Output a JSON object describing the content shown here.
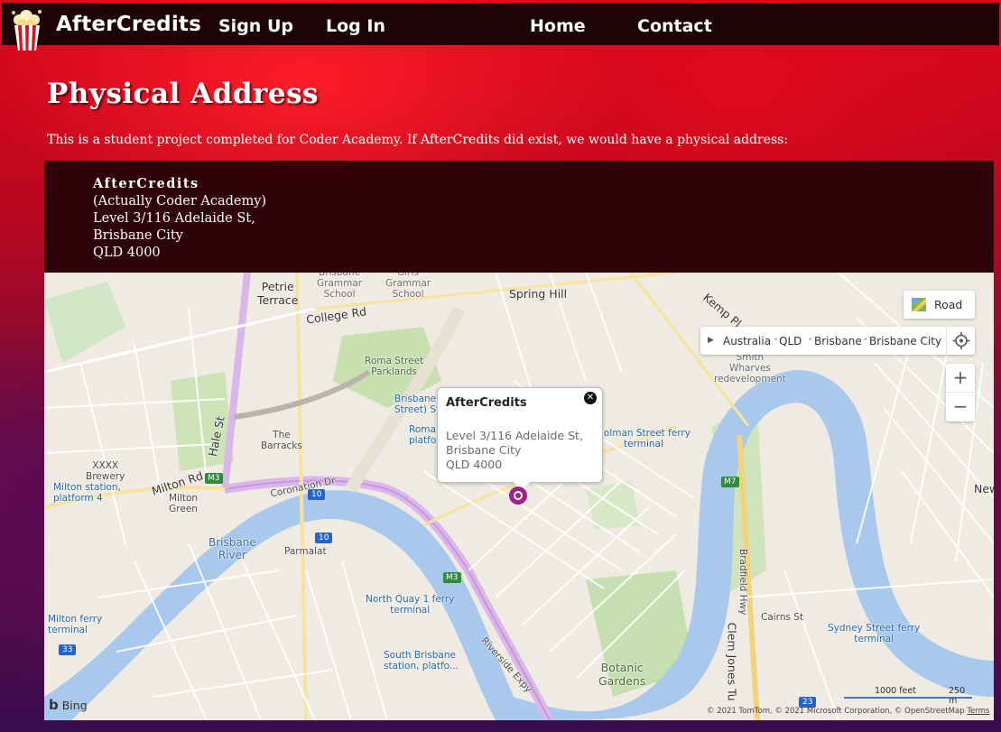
{
  "nav": {
    "brand": "AfterCredits",
    "links": {
      "signup": "Sign Up",
      "login": "Log In",
      "home": "Home",
      "contact": "Contact"
    }
  },
  "page": {
    "title": "Physical Address",
    "intro": "This is a student project completed for Coder Academy. If AfterCredits did exist, we would have a physical address:"
  },
  "address": {
    "name": "AfterCredits",
    "lines": [
      "(Actually Coder Academy)",
      "Level 3/116 Adelaide St,",
      "Brisbane City",
      "QLD 4000"
    ]
  },
  "map": {
    "popup": {
      "title": "AfterCredits",
      "lines": [
        "Level 3/116 Adelaide St,",
        "Brisbane City",
        "QLD 4000"
      ]
    },
    "style_button": "Road",
    "breadcrumb": [
      "Australia",
      "QLD",
      "Brisbane",
      "Brisbane City"
    ],
    "zoom": {
      "in": "+",
      "out": "−"
    },
    "branding": "Bing",
    "scale": {
      "feet": "1000 feet",
      "meters": "250 m"
    },
    "copyright": "© 2021 TomTom, © 2021 Microsoft Corporation, © OpenStreetMap",
    "terms": "Terms",
    "labels": {
      "petrie_terrace": "Petrie\nTerrace",
      "spring_hill": "Spring Hill",
      "brisbane_grammar": "Brisbane\nGrammar\nSchool",
      "girls_grammar": "Girls\nGrammar\nSchool",
      "roma_street": "Roma Street\nParklands",
      "the_barracks": "The\nBarracks",
      "milton": "Milton\nGreen",
      "milton_station": "Milton station,\nplatform 4",
      "brisbane_river": "Brisbane\nRiver",
      "parmalat": "Parmalat",
      "north_quay": "North Quay 1 ferry\nterminal",
      "south_brisbane": "South Brisbane\nstation, platfo...",
      "botanic": "Botanic\nGardens",
      "holman_ferry": "Holman Street ferry\nterminal",
      "sydney_ferry": "Sydney Street ferry\nterminal",
      "smith_wharves": "Smith\nWharves\nredevelopment",
      "milton_ferry": "Milton ferry\nterminal",
      "coronation": "Coronation Dr",
      "riverside_expy": "Riverside Expy",
      "clem_jones": "Clem Jones Tu",
      "bradfield": "Bradfield Hwy",
      "college_rd": "College Rd",
      "milton_rd": "Milton Rd",
      "hale_st": "Hale St",
      "kemp_pl": "Kemp Pl",
      "brisbane_street": "Brisbane\nStreet) St",
      "roma_platform": "Roma\nplatfo",
      "xxxx": "XXXX\nBrewery",
      "cairns_st": "Cairns St",
      "new_farm": "New",
      "m3": "M3",
      "m7": "M7",
      "r10": "10",
      "r33": "33",
      "r23": "23"
    }
  }
}
